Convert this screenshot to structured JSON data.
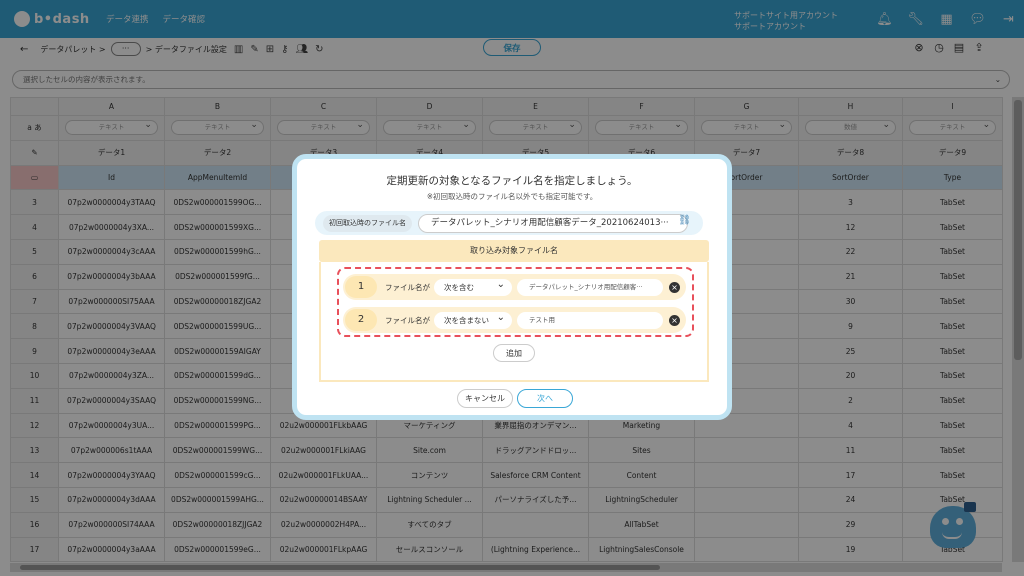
{
  "app": {
    "logo": "b•dash",
    "nav": [
      "データ連携",
      "データ確認"
    ],
    "account_line1": "サポートサイト用アカウント",
    "account_line2": "サポートアカウント",
    "top_icons": [
      "bell-icon",
      "wrench-icon",
      "apps-grid-icon",
      "chat-icon",
      "logout-icon"
    ]
  },
  "toolbar": {
    "back": "←",
    "crumb1": "データパレット >",
    "dots": "···",
    "crumb2": "> データファイル設定",
    "save_label": "保存",
    "left_icons": [
      "columns-icon",
      "edit-icon",
      "table-edit-icon",
      "key-icon",
      "users-icon",
      "refresh-icon"
    ],
    "right_icons": [
      "close-circle-icon",
      "history-icon",
      "document-icon",
      "export-icon"
    ]
  },
  "cellbar": {
    "placeholder": "選択したセルの内容が表示されます。"
  },
  "grid": {
    "col_letters": [
      "A",
      "B",
      "C",
      "D",
      "E",
      "F",
      "G",
      "H",
      "I"
    ],
    "filter_label": "a あ",
    "filter_placeholders": [
      "テキスト",
      "テキスト",
      "テキスト",
      "テキスト",
      "テキスト",
      "テキスト",
      "テキスト",
      "数値",
      "テキスト"
    ],
    "labels": [
      "データ1",
      "データ2",
      "データ3",
      "データ4",
      "データ5",
      "データ6",
      "データ7",
      "データ8",
      "データ9"
    ],
    "fields": [
      "Id",
      "AppMenuItemId",
      "",
      "",
      "",
      "",
      "ortOrder",
      "SortOrder",
      "Type"
    ],
    "rows": [
      {
        "n": "3",
        "c": [
          "07p2w0000004y3TAAQ",
          "0DS2w000001599OG...",
          "02u2w...",
          "",
          "",
          "",
          "",
          "3",
          "TabSet"
        ]
      },
      {
        "n": "4",
        "c": [
          "07p2w0000004y3XA...",
          "0DS2w000001599XG...",
          "02u2...",
          "",
          "",
          "",
          "",
          "12",
          "TabSet"
        ]
      },
      {
        "n": "5",
        "c": [
          "07p2w0000004y3cAAA",
          "0DS2w000001599hG...",
          "02u2...",
          "",
          "",
          "",
          "",
          "22",
          "TabSet"
        ]
      },
      {
        "n": "6",
        "c": [
          "07p2w0000004y3bAAA",
          "0DS2w000001599fG...",
          "02u2...",
          "",
          "",
          "",
          "",
          "21",
          "TabSet"
        ]
      },
      {
        "n": "7",
        "c": [
          "07p2w000000SI75AAA",
          "0DS2w00000018ZJGA2",
          "02u2...",
          "",
          "",
          "",
          "",
          "30",
          "TabSet"
        ]
      },
      {
        "n": "8",
        "c": [
          "07p2w0000004y3VAAQ",
          "0DS2w000001599UG...",
          "02u2...",
          "",
          "",
          "",
          "",
          "9",
          "TabSet"
        ]
      },
      {
        "n": "9",
        "c": [
          "07p2w0000004y3eAAA",
          "0DS2w00000159AIGAY",
          "02u2...",
          "",
          "",
          "",
          "",
          "25",
          "TabSet"
        ]
      },
      {
        "n": "10",
        "c": [
          "07p2w0000004y3ZA...",
          "0DS2w000001599dG...",
          "02u2...",
          "",
          "",
          "",
          "",
          "20",
          "TabSet"
        ]
      },
      {
        "n": "11",
        "c": [
          "07p2w0000004y3SAAQ",
          "0DS2w000001599NG...",
          "02u2...",
          "",
          "",
          "",
          "",
          "2",
          "TabSet"
        ]
      },
      {
        "n": "12",
        "c": [
          "07p2w0000004y3UA...",
          "0DS2w000001599PG...",
          "02u2w000001FLkbAAG",
          "マーケティング",
          "業界屈指のオンデマン...",
          "Marketing",
          "",
          "4",
          "TabSet"
        ]
      },
      {
        "n": "13",
        "c": [
          "07p2w000006s1tAAA",
          "0DS2w000001599WG...",
          "02u2w000001FLkiAAG",
          "Site.com",
          "ドラッグアンドドロッ...",
          "Sites",
          "",
          "11",
          "TabSet"
        ]
      },
      {
        "n": "14",
        "c": [
          "07p2w0000004y3YAAQ",
          "0DS2w000001599cG...",
          "02u2w000001FLkUAA...",
          "コンテンツ",
          "Salesforce CRM Content",
          "Content",
          "",
          "17",
          "TabSet"
        ]
      },
      {
        "n": "15",
        "c": [
          "07p2w0000004y3dAAA",
          "0DS2w000001599AHG...",
          "02u2w00000014BSAAY",
          "Lightning Scheduler ...",
          "パーソナライズした予...",
          "LightningScheduler",
          "",
          "24",
          "TabSet"
        ]
      },
      {
        "n": "16",
        "c": [
          "07p2w000000SI74AAA",
          "0DS2w00000018ZJJGA2",
          "02u2w0000002H4PA...",
          "すべてのタブ",
          "",
          "AllTabSet",
          "",
          "29",
          "TabSet"
        ]
      },
      {
        "n": "17",
        "c": [
          "07p2w0000004y3aAAA",
          "0DS2w000001599eG...",
          "02u2w000001FLkpAAG",
          "セールスコンソール",
          "(Lightning Experience...",
          "LightningSalesConsole",
          "",
          "19",
          "TabSet"
        ]
      }
    ]
  },
  "modal": {
    "title": "定期更新の対象となるファイル名を指定しましょう。",
    "subtitle": "※初回取込時のファイル名以外でも指定可能です。",
    "initial_label": "初回取込時のファイル名",
    "initial_value": "データパレット_シナリオ用配信顧客データ_20210624013···",
    "section_title": "取り込み対象ファイル名",
    "conditions": [
      {
        "num": "1",
        "label": "ファイル名が",
        "op": "次を含む",
        "value": "データパレット_シナリオ用配信顧客···"
      },
      {
        "num": "2",
        "label": "ファイル名が",
        "op": "次を含まない",
        "value": "テスト用"
      }
    ],
    "add_label": "追加",
    "cancel_label": "キャンセル",
    "next_label": "次へ"
  }
}
